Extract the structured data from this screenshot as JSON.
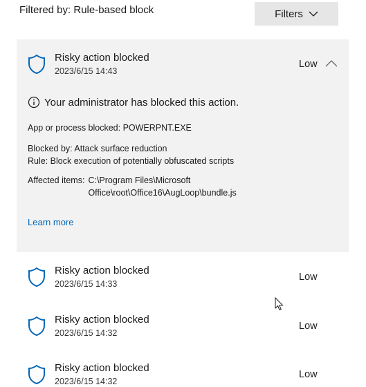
{
  "header": {
    "filter_label": "Filtered by: Rule-based block",
    "filters_button": "Filters"
  },
  "expanded": {
    "title": "Risky action blocked",
    "time": "2023/6/15 14:43",
    "severity": "Low",
    "notice": "Your administrator has blocked this action.",
    "app_line": "App or process blocked: POWERPNT.EXE",
    "blocked_by": "Blocked by:  Attack surface reduction",
    "rule": "Rule:  Block execution of potentially obfuscated scripts",
    "affected_label": "Affected items:",
    "affected_value": "C:\\Program Files\\Microsoft Office\\root\\Office16\\AugLoop\\bundle.js",
    "learn_more": "Learn more"
  },
  "items": [
    {
      "title": "Risky action blocked",
      "time": "2023/6/15 14:33",
      "severity": "Low"
    },
    {
      "title": "Risky action blocked",
      "time": "2023/6/15 14:32",
      "severity": "Low"
    },
    {
      "title": "Risky action blocked",
      "time": "2023/6/15 14:32",
      "severity": "Low"
    }
  ],
  "colors": {
    "accent": "#0067b8",
    "card_bg": "#f2f2f2",
    "button_bg": "#e6e6e6"
  },
  "icons": [
    "shield-icon",
    "info-icon",
    "chevron-down-icon",
    "chevron-up-icon",
    "mouse-cursor-icon"
  ]
}
